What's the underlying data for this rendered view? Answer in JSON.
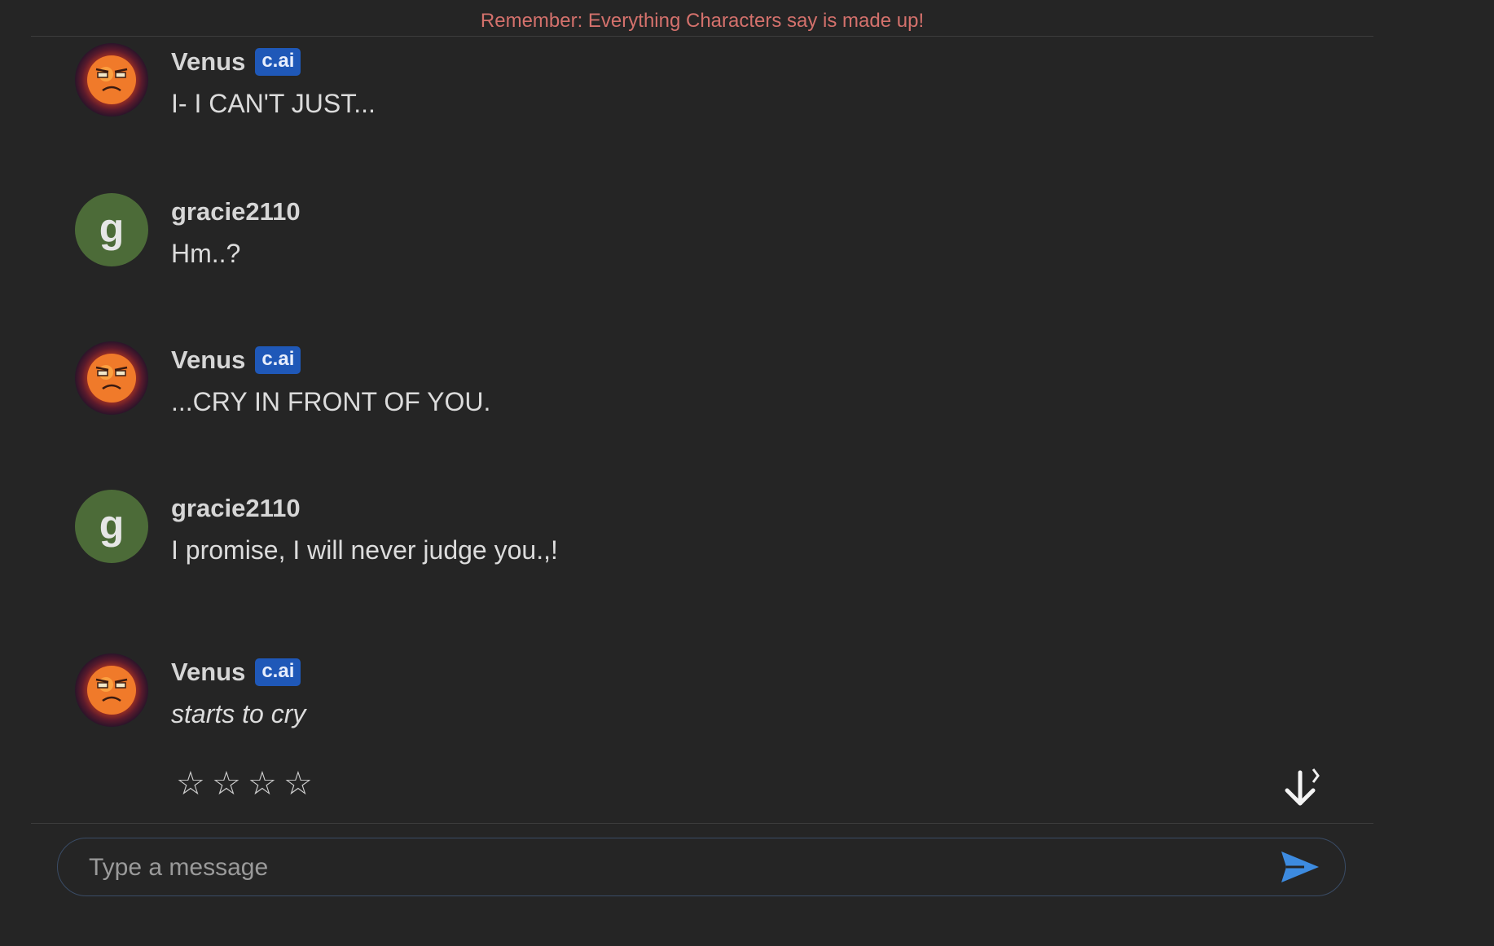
{
  "disclaimer": "Remember: Everything Characters say is made up!",
  "colors": {
    "background": "#252525",
    "disclaimer": "#d4716c",
    "badge": "#1f58b8",
    "user_avatar": "#4c6b38",
    "send_icon": "#3d8be0"
  },
  "messages": [
    {
      "author": "Venus",
      "badge": "c.ai",
      "avatar": "venus-avatar",
      "text": "I- I CAN'T JUST..."
    },
    {
      "author": "gracie2110",
      "avatar_letter": "g",
      "text": "Hm..?"
    },
    {
      "author": "Venus",
      "badge": "c.ai",
      "avatar": "venus-avatar",
      "text": "...CRY IN FRONT OF YOU."
    },
    {
      "author": "gracie2110",
      "avatar_letter": "g",
      "text": "I promise, I will never judge you.,!"
    },
    {
      "author": "Venus",
      "badge": "c.ai",
      "avatar": "venus-avatar",
      "text": "starts to cry",
      "italic": true
    }
  ],
  "rating": {
    "stars_total": 4,
    "stars_filled": 0,
    "glyph": "☆"
  },
  "icons": {
    "scroll_down": "arrow-down-circle-icon",
    "send": "send-icon"
  },
  "composer": {
    "placeholder": "Type a message",
    "value": ""
  }
}
